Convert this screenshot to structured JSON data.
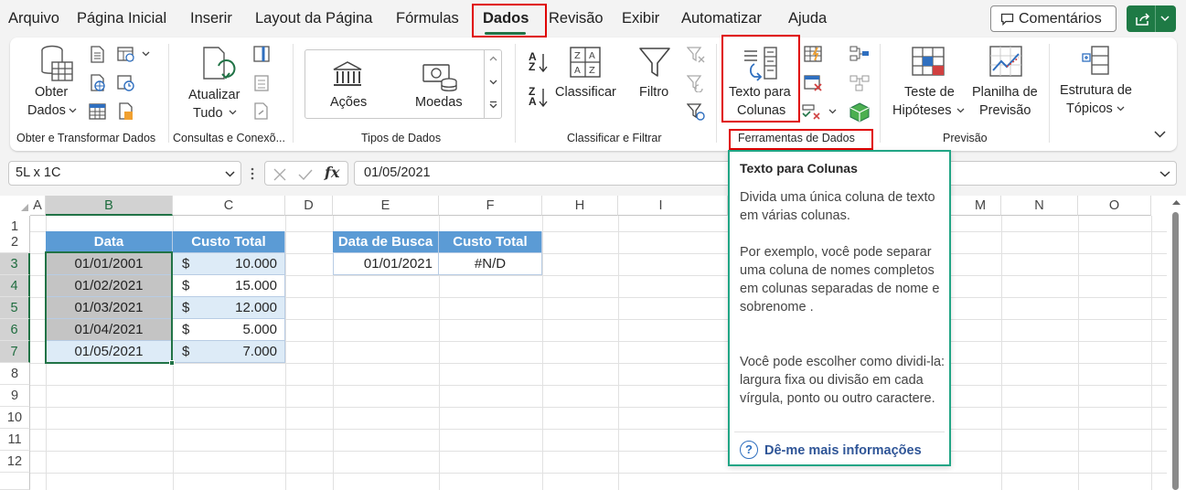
{
  "menu": {
    "tabs": [
      "Arquivo",
      "Página Inicial",
      "Inserir",
      "Layout da Página",
      "Fórmulas",
      "Dados",
      "Revisão",
      "Exibir",
      "Automatizar",
      "Ajuda"
    ],
    "active_tab": "Dados",
    "comments_label": "Comentários"
  },
  "ribbon": {
    "get_data_label_1": "Obter",
    "get_data_label_2": "Dados",
    "refresh_label_1": "Atualizar",
    "refresh_label_2": "Tudo",
    "stocks_label": "Ações",
    "currencies_label": "Moedas",
    "sort_label": "Classificar",
    "filter_label": "Filtro",
    "text_to_columns_label_1": "Texto para",
    "text_to_columns_label_2": "Colunas",
    "whatif_label_1": "Teste de",
    "whatif_label_2": "Hipóteses",
    "forecast_label_1": "Planilha de",
    "forecast_label_2": "Previsão",
    "outline_label_1": "Estrutura de",
    "outline_label_2": "Tópicos",
    "groups": {
      "get_transform": "Obter e Transformar Dados",
      "queries": "Consultas e Conexõ...",
      "data_types": "Tipos de Dados",
      "sort_filter": "Classificar e Filtrar",
      "data_tools": "Ferramentas de Dados",
      "forecast": "Previsão"
    }
  },
  "formula_bar": {
    "name_box": "5L x 1C",
    "fx": "fx",
    "value": "01/05/2021"
  },
  "columns": [
    "A",
    "B",
    "C",
    "D",
    "E",
    "F",
    "H",
    "I",
    "M",
    "N",
    "O"
  ],
  "rows": [
    "1",
    "2",
    "3",
    "4",
    "5",
    "6",
    "7",
    "8",
    "9",
    "10",
    "11",
    "12"
  ],
  "table1": {
    "headers": [
      "Data",
      "Custo Total"
    ],
    "rows": [
      {
        "date": "01/01/2001",
        "cur": "$",
        "amount": "10.000"
      },
      {
        "date": "01/02/2021",
        "cur": "$",
        "amount": "15.000"
      },
      {
        "date": "01/03/2021",
        "cur": "$",
        "amount": "12.000"
      },
      {
        "date": "01/04/2021",
        "cur": "$",
        "amount": "5.000"
      },
      {
        "date": "01/05/2021",
        "cur": "$",
        "amount": "7.000"
      }
    ]
  },
  "table2": {
    "headers": [
      "Data de Busca",
      "Custo Total"
    ],
    "date": "01/01/2021",
    "result": "#N/D"
  },
  "tooltip": {
    "title": "Texto para Colunas",
    "p1": "Divida uma única coluna de texto em várias colunas.",
    "p2": "Por exemplo, você pode separar uma coluna de nomes completos em colunas separadas de nome e sobrenome .",
    "p3": "Você pode escolher como dividi-la: largura fixa ou divisão em cada vírgula, ponto ou outro caractere.",
    "link": "Dê-me mais informações"
  },
  "colors": {
    "accent": "#217346",
    "header_blue": "#5b9bd5",
    "highlight_red": "#e00000",
    "tooltip_border": "#21a585"
  }
}
